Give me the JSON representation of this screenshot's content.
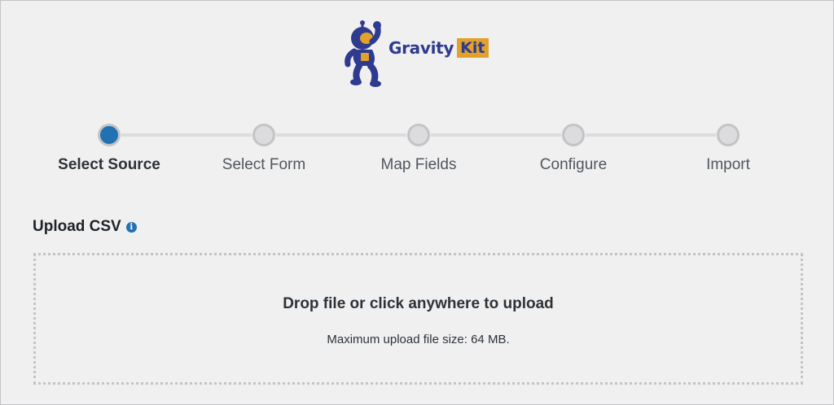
{
  "logo": {
    "brand": "Gravity",
    "brand_accent": "Kit",
    "icon": "astronaut-icon",
    "colors": {
      "navy": "#2e3b8f",
      "gold": "#e1a12a"
    }
  },
  "stepper": {
    "steps": [
      {
        "label": "Select Source",
        "active": true
      },
      {
        "label": "Select Form",
        "active": false
      },
      {
        "label": "Map Fields",
        "active": false
      },
      {
        "label": "Configure",
        "active": false
      },
      {
        "label": "Import",
        "active": false
      }
    ],
    "active_color": "#2271b1"
  },
  "upload": {
    "title": "Upload CSV",
    "info_icon": "info-icon",
    "dropzone_title": "Drop file or click anywhere to upload",
    "dropzone_subtitle": "Maximum upload file size: 64 MB."
  }
}
